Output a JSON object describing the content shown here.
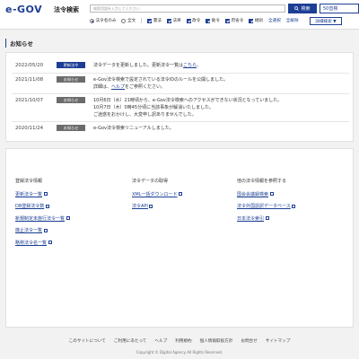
{
  "header": {
    "logo": "e-GOV",
    "site_title": "法令検索",
    "search_placeholder": "検索用語を入力してください",
    "search_button": "検索",
    "lang_button": "50音検",
    "options": {
      "scope": [
        {
          "label": "法令名のみ",
          "checked": true
        },
        {
          "label": "全文",
          "checked": false
        }
      ],
      "types": [
        {
          "label": "憲法",
          "checked": true
        },
        {
          "label": "法律",
          "checked": true
        },
        {
          "label": "政令",
          "checked": true
        },
        {
          "label": "勅令",
          "checked": true
        },
        {
          "label": "府省令",
          "checked": true
        },
        {
          "label": "規則",
          "checked": true
        }
      ],
      "select_all": "全選択",
      "deselect_all": "全解除"
    },
    "detail_button": "詳細検索 ▼"
  },
  "notices": {
    "title": "お知らせ",
    "items": [
      {
        "date": "2022/05/20",
        "badge": "更新法令",
        "badge_type": "new",
        "lines": [
          "法令データを更新しました。更新法令一覧は",
          "こちら",
          "。"
        ]
      },
      {
        "date": "2021/11/08",
        "badge": "お知らせ",
        "badge_type": "info",
        "lines": [
          "e-Gov法令検索で設定されている法令IDのルールを公開しました。",
          "詳細は、",
          "ヘルプ",
          "をご参照ください。"
        ]
      },
      {
        "date": "2021/10/07",
        "badge": "お知らせ",
        "badge_type": "info",
        "lines": [
          "10月6日（水）21時頃から、e-Gov法令検索へのアクセスができない状況となっていました。",
          "10月7日（木）0時45分頃に当該事象が解消いたしました。",
          "ご迷惑をおかけし、大変申し訳ありませんでした。"
        ]
      },
      {
        "date": "2020/11/24",
        "badge": "お知らせ",
        "badge_type": "info",
        "lines": [
          "e-Gov法令検索リニューアルしました。"
        ]
      }
    ]
  },
  "columns": [
    {
      "title": "登録法令情報",
      "links": [
        "更新法令一覧",
        "DB登録法令数",
        "新規制定未施行法令一覧",
        "廃止法令一覧",
        "略称法令名一覧"
      ]
    },
    {
      "title": "法令データの取得",
      "links": [
        "XML一括ダウンロード",
        "法令API"
      ]
    },
    {
      "title": "他の法令情報を参照する",
      "links": [
        "国会会議録検索",
        "法令外国語訳データベース",
        "日本法令索引"
      ]
    }
  ],
  "footer": {
    "links": [
      "このサイトについて",
      "ご利用にあたって",
      "ヘルプ",
      "利用規約",
      "個人情報取扱方針",
      "お問合せ",
      "サイトマップ"
    ],
    "copyright": "Copyright © Digital Agency All Rights Reserved."
  }
}
